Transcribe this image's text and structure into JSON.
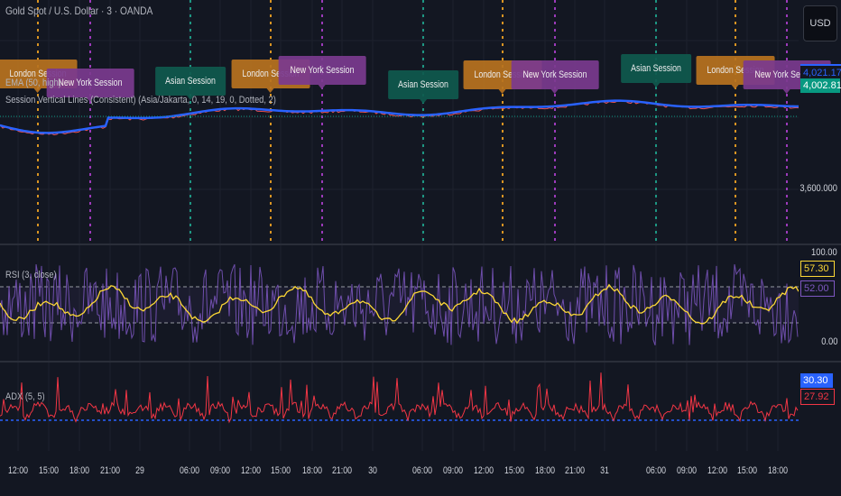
{
  "header": {
    "symbol_title": "Gold Spot / U.S. Dollar · 3 · OANDA",
    "ema_legend": "EMA (50, high)",
    "session_legend": "Session Vertical Lines (Consistent) (Asia/Jakarta, 0, 14, 19, 0, Dotted, 2)"
  },
  "currency_button": "USD",
  "price_axis": {
    "ema_value": "4,021.174",
    "last_price": "4,002.810",
    "tick_3600": "3,600.000"
  },
  "rsi": {
    "legend": "RSI (3, close)",
    "top": "100.00",
    "bottom": "0.00",
    "value": "57.30",
    "ma_value": "52.00"
  },
  "adx": {
    "legend": "ADX (5, 5)",
    "value": "30.30",
    "value2": "27.92"
  },
  "time_axis": [
    "12:00",
    "15:00",
    "18:00",
    "21:00",
    "29",
    "06:00",
    "09:00",
    "12:00",
    "15:00",
    "18:00",
    "21:00",
    "30",
    "06:00",
    "09:00",
    "12:00",
    "15:00",
    "18:00",
    "21:00",
    "31",
    "06:00",
    "09:00",
    "12:00",
    "15:00",
    "18:00"
  ],
  "sessions": [
    {
      "type": "london",
      "label": "London Session"
    },
    {
      "type": "newyork",
      "label": "New York Session"
    },
    {
      "type": "asian",
      "label": "Asian Session"
    },
    {
      "type": "london",
      "label": "London Session"
    },
    {
      "type": "newyork",
      "label": "New York Session"
    },
    {
      "type": "asian",
      "label": "Asian Session"
    },
    {
      "type": "london",
      "label": "London Session"
    },
    {
      "type": "newyork",
      "label": "New York Session"
    },
    {
      "type": "asian",
      "label": "Asian Session"
    },
    {
      "type": "london",
      "label": "London Session"
    },
    {
      "type": "newyork",
      "label": "New York Session"
    }
  ],
  "colors": {
    "london": "#b8731f",
    "newyork": "#7b3a8f",
    "asian": "#0f5a4e",
    "ema": "#2962ff",
    "price": "#26a69a",
    "rsi": "#7e57c2",
    "rsi_ma": "#fdd835",
    "adx": "#f23645",
    "adx_ref": "#2962ff"
  }
}
